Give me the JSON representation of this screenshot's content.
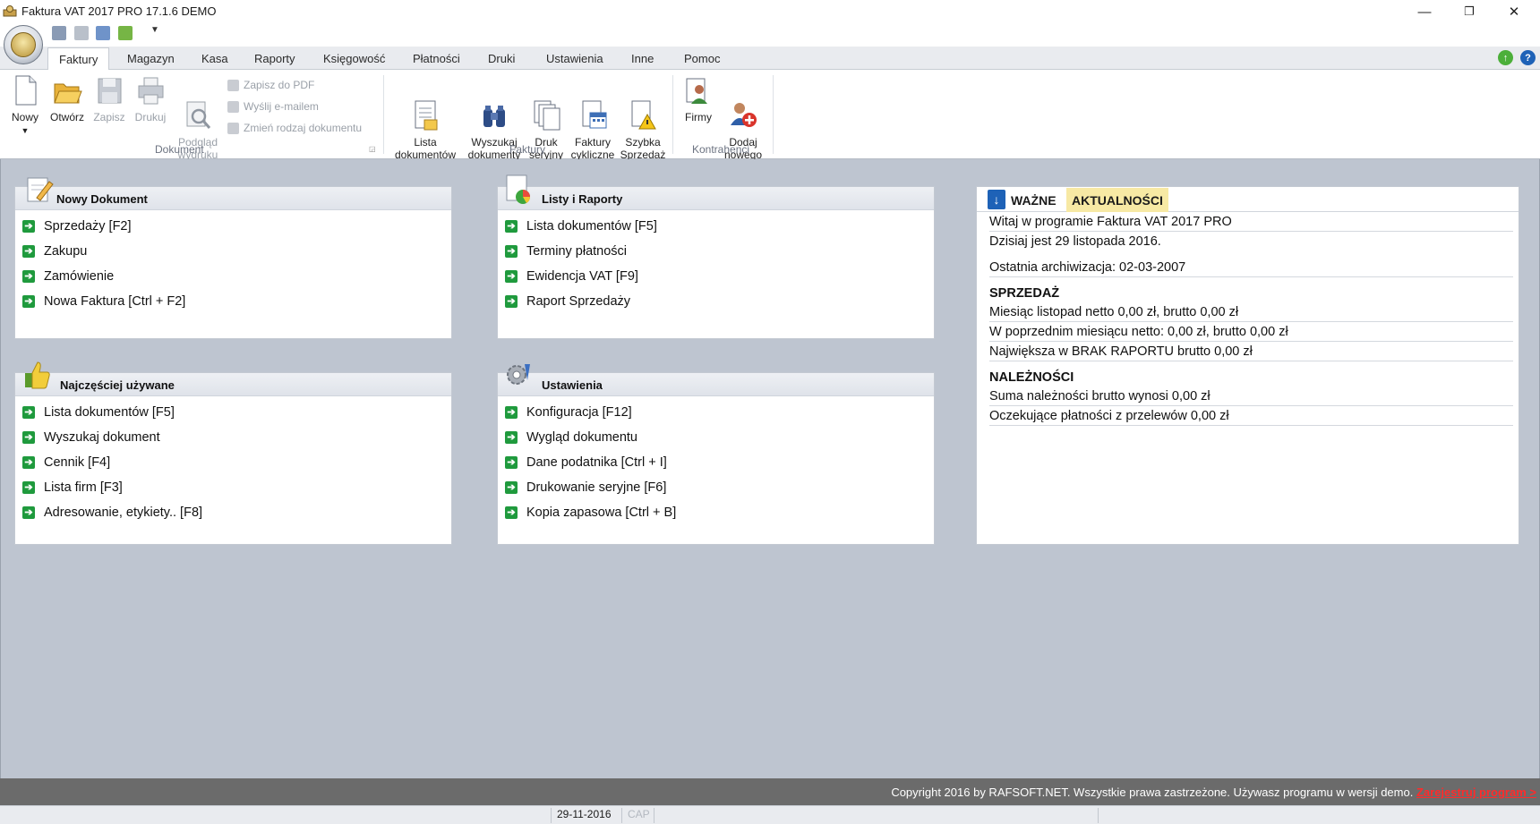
{
  "window": {
    "title": "Faktura VAT 2017 PRO 17.1.6 DEMO",
    "minimize": "—",
    "restore": "❐",
    "close": "✕"
  },
  "tabs": [
    "Faktury",
    "Magazyn",
    "Kasa",
    "Raporty",
    "Księgowość",
    "Płatności",
    "Druki",
    "Ustawienia",
    "Inne",
    "Pomoc"
  ],
  "ribbon": {
    "dokument": {
      "label": "Dokument",
      "buttons": [
        "Nowy",
        "Otwórz",
        "Zapisz",
        "Drukuj",
        "Podgląd\nwydruku"
      ],
      "small": [
        "Zapisz do PDF",
        "Wyślij e-mailem",
        "Zmień rodzaj dokumentu"
      ]
    },
    "faktury": {
      "label": "Faktury",
      "buttons": [
        "Lista\ndokumentów",
        "Wyszukaj\ndokumenty",
        "Druk\nseryjny",
        "Faktury\ncykliczne",
        "Szybka\nSprzedaż"
      ]
    },
    "kontrahenci": {
      "label": "Kontrahenci",
      "buttons": [
        "Firmy",
        "Dodaj\nnowego"
      ]
    }
  },
  "panels": {
    "nowy": {
      "title": "Nowy Dokument",
      "items": [
        "Sprzedaży [F2]",
        "Zakupu",
        "Zamówienie",
        "Nowa Faktura [Ctrl + F2]"
      ]
    },
    "listy": {
      "title": "Listy i Raporty",
      "items": [
        "Lista dokumentów [F5]",
        "Terminy płatności",
        "Ewidencja VAT [F9]",
        "Raport Sprzedaży"
      ]
    },
    "najczesciej": {
      "title": "Najczęściej używane",
      "items": [
        "Lista dokumentów [F5]",
        "Wyszukaj dokument",
        "Cennik [F4]",
        "Lista firm [F3]",
        "Adresowanie, etykiety.. [F8]"
      ]
    },
    "ustawienia": {
      "title": "Ustawienia",
      "items": [
        "Konfiguracja [F12]",
        "Wygląd dokumentu",
        "Dane podatnika [Ctrl + I]",
        "Drukowanie seryjne [F6]",
        "Kopia zapasowa [Ctrl + B]"
      ]
    }
  },
  "info": {
    "tab_wazne": "WAŻNE",
    "tab_aktualnosci": "AKTUALNOŚCI",
    "welcome": "Witaj w programie Faktura VAT 2017 PRO",
    "today": "Dzisiaj jest 29 listopada 2016.",
    "archive": "Ostatnia archiwizacja: 02-03-2007",
    "sprzedaz_head": "SPRZEDAŻ",
    "sprzedaz_lines": [
      "Miesiąc listopad netto 0,00 zł, brutto 0,00 zł",
      "W poprzednim miesiącu netto: 0,00 zł, brutto 0,00 zł",
      "Największa w BRAK RAPORTU brutto 0,00 zł"
    ],
    "naleznosci_head": "NALEŻNOŚCI",
    "naleznosci_lines": [
      "Suma należności brutto wynosi 0,00 zł",
      "Oczekujące płatności z przelewów 0,00 zł"
    ]
  },
  "footer": {
    "copyright": "Copyright 2016 by RAFSOFT.NET. Wszystkie prawa zastrzeżone. Używasz programu w wersji demo.",
    "register": "Zarejestruj program >"
  },
  "status": {
    "date": "29-11-2016",
    "caps": "CAP"
  },
  "colors": {
    "arrow": "#1f9a3d",
    "background": "#bec5d0",
    "register_link": "#ff2b2b",
    "news_tab": "#f7e9a4"
  }
}
